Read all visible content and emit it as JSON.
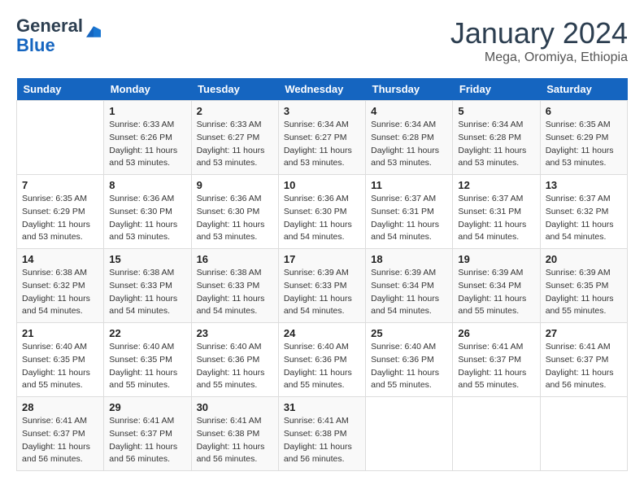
{
  "header": {
    "logo_line1": "General",
    "logo_line2": "Blue",
    "month": "January 2024",
    "location": "Mega, Oromiya, Ethiopia"
  },
  "weekdays": [
    "Sunday",
    "Monday",
    "Tuesday",
    "Wednesday",
    "Thursday",
    "Friday",
    "Saturday"
  ],
  "weeks": [
    [
      {
        "day": "",
        "info": ""
      },
      {
        "day": "1",
        "info": "Sunrise: 6:33 AM\nSunset: 6:26 PM\nDaylight: 11 hours\nand 53 minutes."
      },
      {
        "day": "2",
        "info": "Sunrise: 6:33 AM\nSunset: 6:27 PM\nDaylight: 11 hours\nand 53 minutes."
      },
      {
        "day": "3",
        "info": "Sunrise: 6:34 AM\nSunset: 6:27 PM\nDaylight: 11 hours\nand 53 minutes."
      },
      {
        "day": "4",
        "info": "Sunrise: 6:34 AM\nSunset: 6:28 PM\nDaylight: 11 hours\nand 53 minutes."
      },
      {
        "day": "5",
        "info": "Sunrise: 6:34 AM\nSunset: 6:28 PM\nDaylight: 11 hours\nand 53 minutes."
      },
      {
        "day": "6",
        "info": "Sunrise: 6:35 AM\nSunset: 6:29 PM\nDaylight: 11 hours\nand 53 minutes."
      }
    ],
    [
      {
        "day": "7",
        "info": "Sunrise: 6:35 AM\nSunset: 6:29 PM\nDaylight: 11 hours\nand 53 minutes."
      },
      {
        "day": "8",
        "info": "Sunrise: 6:36 AM\nSunset: 6:30 PM\nDaylight: 11 hours\nand 53 minutes."
      },
      {
        "day": "9",
        "info": "Sunrise: 6:36 AM\nSunset: 6:30 PM\nDaylight: 11 hours\nand 53 minutes."
      },
      {
        "day": "10",
        "info": "Sunrise: 6:36 AM\nSunset: 6:30 PM\nDaylight: 11 hours\nand 54 minutes."
      },
      {
        "day": "11",
        "info": "Sunrise: 6:37 AM\nSunset: 6:31 PM\nDaylight: 11 hours\nand 54 minutes."
      },
      {
        "day": "12",
        "info": "Sunrise: 6:37 AM\nSunset: 6:31 PM\nDaylight: 11 hours\nand 54 minutes."
      },
      {
        "day": "13",
        "info": "Sunrise: 6:37 AM\nSunset: 6:32 PM\nDaylight: 11 hours\nand 54 minutes."
      }
    ],
    [
      {
        "day": "14",
        "info": "Sunrise: 6:38 AM\nSunset: 6:32 PM\nDaylight: 11 hours\nand 54 minutes."
      },
      {
        "day": "15",
        "info": "Sunrise: 6:38 AM\nSunset: 6:33 PM\nDaylight: 11 hours\nand 54 minutes."
      },
      {
        "day": "16",
        "info": "Sunrise: 6:38 AM\nSunset: 6:33 PM\nDaylight: 11 hours\nand 54 minutes."
      },
      {
        "day": "17",
        "info": "Sunrise: 6:39 AM\nSunset: 6:33 PM\nDaylight: 11 hours\nand 54 minutes."
      },
      {
        "day": "18",
        "info": "Sunrise: 6:39 AM\nSunset: 6:34 PM\nDaylight: 11 hours\nand 54 minutes."
      },
      {
        "day": "19",
        "info": "Sunrise: 6:39 AM\nSunset: 6:34 PM\nDaylight: 11 hours\nand 55 minutes."
      },
      {
        "day": "20",
        "info": "Sunrise: 6:39 AM\nSunset: 6:35 PM\nDaylight: 11 hours\nand 55 minutes."
      }
    ],
    [
      {
        "day": "21",
        "info": "Sunrise: 6:40 AM\nSunset: 6:35 PM\nDaylight: 11 hours\nand 55 minutes."
      },
      {
        "day": "22",
        "info": "Sunrise: 6:40 AM\nSunset: 6:35 PM\nDaylight: 11 hours\nand 55 minutes."
      },
      {
        "day": "23",
        "info": "Sunrise: 6:40 AM\nSunset: 6:36 PM\nDaylight: 11 hours\nand 55 minutes."
      },
      {
        "day": "24",
        "info": "Sunrise: 6:40 AM\nSunset: 6:36 PM\nDaylight: 11 hours\nand 55 minutes."
      },
      {
        "day": "25",
        "info": "Sunrise: 6:40 AM\nSunset: 6:36 PM\nDaylight: 11 hours\nand 55 minutes."
      },
      {
        "day": "26",
        "info": "Sunrise: 6:41 AM\nSunset: 6:37 PM\nDaylight: 11 hours\nand 55 minutes."
      },
      {
        "day": "27",
        "info": "Sunrise: 6:41 AM\nSunset: 6:37 PM\nDaylight: 11 hours\nand 56 minutes."
      }
    ],
    [
      {
        "day": "28",
        "info": "Sunrise: 6:41 AM\nSunset: 6:37 PM\nDaylight: 11 hours\nand 56 minutes."
      },
      {
        "day": "29",
        "info": "Sunrise: 6:41 AM\nSunset: 6:37 PM\nDaylight: 11 hours\nand 56 minutes."
      },
      {
        "day": "30",
        "info": "Sunrise: 6:41 AM\nSunset: 6:38 PM\nDaylight: 11 hours\nand 56 minutes."
      },
      {
        "day": "31",
        "info": "Sunrise: 6:41 AM\nSunset: 6:38 PM\nDaylight: 11 hours\nand 56 minutes."
      },
      {
        "day": "",
        "info": ""
      },
      {
        "day": "",
        "info": ""
      },
      {
        "day": "",
        "info": ""
      }
    ]
  ]
}
